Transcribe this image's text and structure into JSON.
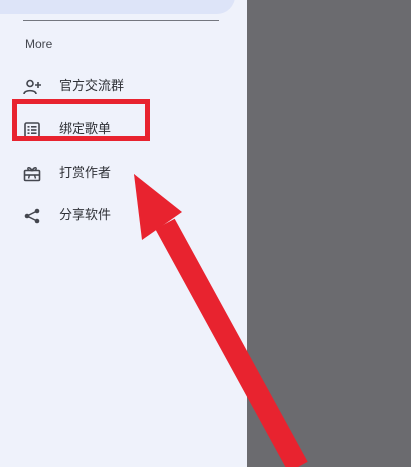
{
  "drawer": {
    "section_title": "More",
    "items": [
      {
        "label": "官方交流群",
        "icon": "group-add-icon"
      },
      {
        "label": "绑定歌单",
        "icon": "playlist-icon"
      },
      {
        "label": "打赏作者",
        "icon": "gift-icon"
      },
      {
        "label": "分享软件",
        "icon": "share-icon"
      }
    ]
  },
  "annotation": {
    "highlight_target": "绑定歌单",
    "box_color": "#e8232f",
    "arrow_color": "#e8232f"
  },
  "colors": {
    "drawer_background": "#eff2fb",
    "scrim": "#6b6b6f",
    "icon": "#44474f",
    "text": "#2f3137"
  }
}
